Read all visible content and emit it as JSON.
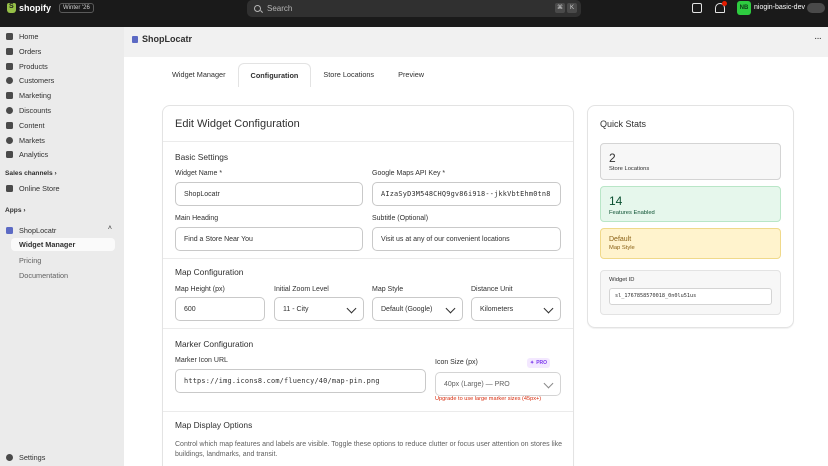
{
  "topbar": {
    "brand": "shopify",
    "edition": "Winter '26",
    "search_placeholder": "Search",
    "shortcut_keys": [
      "⌘",
      "K"
    ],
    "avatar_initials": "NB",
    "account_name": "niogin-basic-dev"
  },
  "sidebar": {
    "items": [
      {
        "label": "Home",
        "icon": "home-icon"
      },
      {
        "label": "Orders",
        "icon": "orders-icon"
      },
      {
        "label": "Products",
        "icon": "products-icon"
      },
      {
        "label": "Customers",
        "icon": "customers-icon"
      },
      {
        "label": "Marketing",
        "icon": "marketing-icon"
      },
      {
        "label": "Discounts",
        "icon": "discounts-icon"
      },
      {
        "label": "Content",
        "icon": "content-icon"
      },
      {
        "label": "Markets",
        "icon": "markets-icon"
      },
      {
        "label": "Analytics",
        "icon": "analytics-icon"
      }
    ],
    "sales_channels_label": "Sales channels",
    "online_store": "Online Store",
    "apps_label": "Apps",
    "app_name": "ShopLocatr",
    "app_subitems": [
      "Widget Manager",
      "Pricing",
      "Documentation"
    ],
    "settings": "Settings"
  },
  "app": {
    "title": "ShopLocatr",
    "tabs": [
      "Widget Manager",
      "Configuration",
      "Store Locations",
      "Preview"
    ],
    "active_tab": "Configuration"
  },
  "config": {
    "title": "Edit Widget Configuration",
    "basic": {
      "heading": "Basic Settings",
      "widget_name_label": "Widget Name *",
      "widget_name_value": "ShopLocatr",
      "api_key_label": "Google Maps API Key *",
      "api_key_value": "AIzaSyD3M548CHQ9gv86i918--jkkVbtEhm0tn8",
      "main_heading_label": "Main Heading",
      "main_heading_value": "Find a Store Near You",
      "subtitle_label": "Subtitle (Optional)",
      "subtitle_value": "Visit us at any of our convenient locations"
    },
    "map": {
      "heading": "Map Configuration",
      "height_label": "Map Height (px)",
      "height_value": "600",
      "zoom_label": "Initial Zoom Level",
      "zoom_value": "11 - City",
      "style_label": "Map Style",
      "style_value": "Default (Google)",
      "unit_label": "Distance Unit",
      "unit_value": "Kilometers"
    },
    "marker": {
      "heading": "Marker Configuration",
      "icon_url_label": "Marker Icon URL",
      "icon_url_value": "https://img.icons8.com/fluency/40/map-pin.png",
      "icon_size_label": "Icon Size (px)",
      "pro_badge": "PRO",
      "icon_size_value": "40px (Large) — PRO",
      "upgrade_note": "Upgrade to use large marker sizes (45px+)"
    },
    "display": {
      "heading": "Map Display Options",
      "description": "Control which map features and labels are visible. Toggle these options to reduce clutter or focus user attention on stores like buildings, landmarks, and transit."
    }
  },
  "stats": {
    "title": "Quick Stats",
    "store_locations_value": "2",
    "store_locations_label": "Store Locations",
    "features_value": "14",
    "features_label": "Features Enabled",
    "map_style_value": "Default",
    "map_style_label": "Map Style",
    "widget_id_label": "Widget ID",
    "widget_id_value": "sl_1767858570018_0n0lu51us"
  },
  "colors": {
    "topbar": "#1a1a1a",
    "sidebar": "#ebebeb",
    "stat_features_text": "#0c5132",
    "stat_style_text": "#8a6116",
    "upgrade_note": "#d72c0d"
  }
}
